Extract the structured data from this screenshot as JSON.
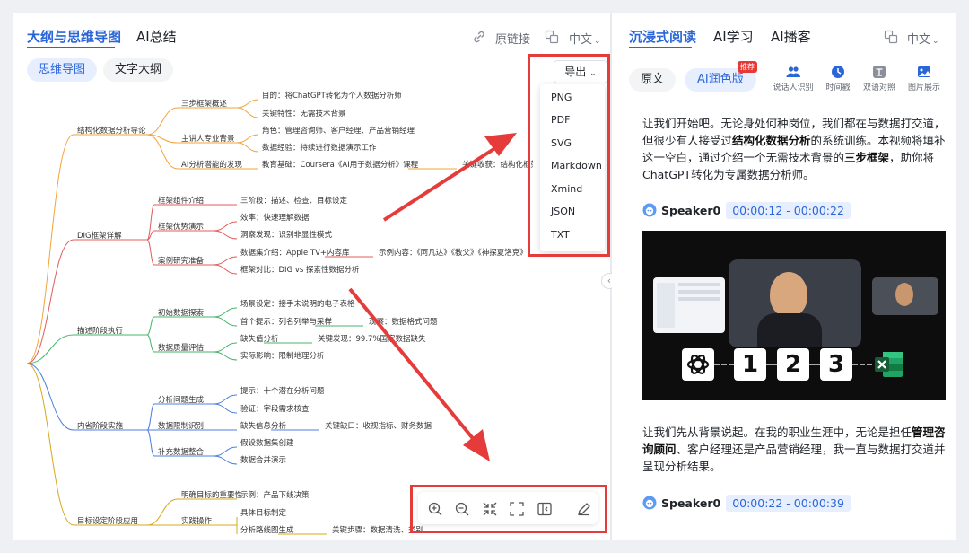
{
  "left": {
    "tabs": [
      {
        "label": "大纲与思维导图",
        "active": true
      },
      {
        "label": "AI总结",
        "active": false
      }
    ],
    "header_right": {
      "link": "原链接",
      "lang": "中文"
    },
    "sub_tabs": [
      {
        "label": "思维导图",
        "active": true
      },
      {
        "label": "文字大纲",
        "active": false
      }
    ],
    "export": {
      "label": "导出",
      "options": [
        "PNG",
        "PDF",
        "SVG",
        "Markdown",
        "Xmind",
        "JSON",
        "TXT"
      ]
    },
    "mindmap": {
      "branches": [
        {
          "label": "结构化数据分析导论",
          "children": [
            {
              "label": "三步框架概述",
              "leaves": [
                "目的：将ChatGPT转化为个人数据分析师",
                "关键特性：无需技术背景"
              ]
            },
            {
              "label": "主讲人专业背景",
              "leaves": [
                "角色：管理咨询师、客户经理、产品营销经理",
                "数据经验：持续进行数据演示工作"
              ]
            },
            {
              "label": "AI分析潜能的发现",
              "leaves": [
                "教育基础：Coursera《AI用于数据分析》课程",
                "关键收获：结构化框架对"
              ]
            }
          ]
        },
        {
          "label": "DIG框架详解",
          "children": [
            {
              "label": "框架组件介绍",
              "leaves": [
                "三阶段：描述、检查、目标设定"
              ]
            },
            {
              "label": "框架优势演示",
              "leaves": [
                "效率：快速理解数据",
                "洞察发现：识别非显性模式"
              ]
            },
            {
              "label": "案例研究准备",
              "leaves": [
                "数据集介绍：Apple TV+内容库",
                "示例内容：《阿凡达》《教父》《神探夏洛克》",
                "框架对比：DIG vs 探索性数据分析"
              ]
            }
          ]
        },
        {
          "label": "描述阶段执行",
          "children": [
            {
              "label": "初始数据探索",
              "leaves": [
                "场景设定：接手未说明的电子表格",
                "首个提示：列名列举与采样",
                "观察：数据格式问题"
              ]
            },
            {
              "label": "数据质量评估",
              "leaves": [
                "缺失值分析",
                "关键发现：99.7%国家数据缺失",
                "实际影响：限制地理分析"
              ]
            }
          ]
        },
        {
          "label": "内省阶段实施",
          "children": [
            {
              "label": "分析问题生成",
              "leaves": [
                "提示：十个潜在分析问题",
                "验证：字段需求核查"
              ]
            },
            {
              "label": "数据限制识别",
              "leaves": [
                "缺失信息分析",
                "关键缺口：收视指标、财务数据"
              ]
            },
            {
              "label": "补充数据整合",
              "leaves": [
                "假设数据集创建",
                "数据合并演示"
              ]
            }
          ]
        },
        {
          "label": "目标设定阶段应用",
          "children": [
            {
              "label": "明确目标的重要性",
              "leaves": [
                "示例：产品下线决策"
              ]
            },
            {
              "label": "实践操作",
              "leaves": [
                "具体目标制定",
                "分析路线图生成",
                "关键步骤：数据清洗、类别"
              ]
            }
          ]
        }
      ]
    }
  },
  "right": {
    "tabs": [
      {
        "label": "沉浸式阅读",
        "active": true
      },
      {
        "label": "AI学习",
        "active": false
      },
      {
        "label": "AI播客",
        "active": false
      }
    ],
    "lang": "中文",
    "modes": [
      {
        "label": "原文",
        "active": false
      },
      {
        "label": "AI润色版",
        "active": true,
        "badge": "推荐"
      }
    ],
    "tools": [
      "说话人识别",
      "时间戳",
      "双语对照",
      "图片展示"
    ],
    "para1_parts": [
      "让我们开始吧。无论身处何种岗位，我们都在与数据打交道，但很少有人接受过",
      "结构化数据分析",
      "的系统训练。本视频将填补这一空白，通过介绍一个无需技术背景的",
      "三步框架",
      "，助你将ChatGPT转化为专属数据分析师。"
    ],
    "speaker1": {
      "name": "Speaker0",
      "time": "00:00:12 - 00:00:22"
    },
    "video_numbers": [
      "1",
      "2",
      "3"
    ],
    "para2_parts": [
      "让我们先从背景说起。在我的职业生涯中，无论是担任",
      "管理咨询顾问",
      "、客户经理还是产品营销经理，我一直与数据打交道并呈现分析结果。"
    ],
    "speaker2": {
      "name": "Speaker0",
      "time": "00:00:22 - 00:00:39"
    }
  },
  "colors": {
    "accent": "#2b66d9",
    "annotation_red": "#e63b3b",
    "branch_orange": "#f1a33b",
    "branch_red": "#e35d5d",
    "branch_green": "#49b36b",
    "branch_blue": "#4a7fe0",
    "branch_gold": "#d7a81b"
  }
}
